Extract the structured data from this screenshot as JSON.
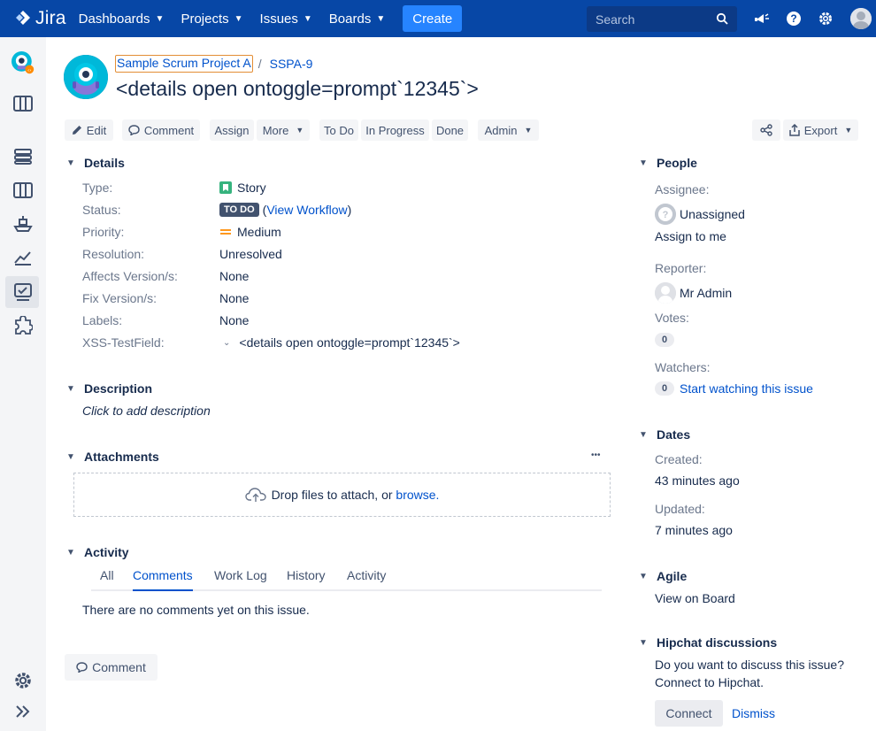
{
  "nav": {
    "logo_text": "Jira",
    "items": [
      {
        "label": "Dashboards"
      },
      {
        "label": "Projects"
      },
      {
        "label": "Issues"
      },
      {
        "label": "Boards"
      }
    ],
    "create_label": "Create",
    "search_placeholder": "Search"
  },
  "header": {
    "project_name": "Sample Scrum Project A",
    "separator": "/",
    "issue_key": "SSPA-9",
    "title": "<details open ontoggle=prompt`12345`>"
  },
  "toolbar": {
    "edit": "Edit",
    "comment": "Comment",
    "assign": "Assign",
    "more": "More",
    "todo": "To Do",
    "in_progress": "In Progress",
    "done": "Done",
    "admin": "Admin",
    "export": "Export"
  },
  "details": {
    "heading": "Details",
    "fields": [
      {
        "label": "Type:",
        "value": "Story"
      },
      {
        "label": "Status:",
        "value": "TO DO",
        "extra_open": "(",
        "link": "View Workflow",
        "extra_close": ")"
      },
      {
        "label": "Priority:",
        "value": "Medium"
      },
      {
        "label": "Resolution:",
        "value": "Unresolved"
      },
      {
        "label": "Affects Version/s:",
        "value": "None"
      },
      {
        "label": "Fix Version/s:",
        "value": "None"
      },
      {
        "label": "Labels:",
        "value": "None"
      },
      {
        "label": "XSS-TestField:",
        "value": "<details open ontoggle=prompt`12345`>"
      }
    ]
  },
  "description": {
    "heading": "Description",
    "placeholder": "Click to add description"
  },
  "attachments": {
    "heading": "Attachments",
    "more": "•••",
    "drop_text": "Drop files to attach, or",
    "browse": "browse."
  },
  "activity": {
    "heading": "Activity",
    "tabs": [
      "All",
      "Comments",
      "Work Log",
      "History",
      "Activity"
    ],
    "active_tab": "Comments",
    "empty": "There are no comments yet on this issue.",
    "comment_button": "Comment"
  },
  "people": {
    "heading": "People",
    "assignee_label": "Assignee:",
    "assignee": "Unassigned",
    "assign_to_me": "Assign to me",
    "reporter_label": "Reporter:",
    "reporter": "Mr Admin",
    "votes_label": "Votes:",
    "votes": "0",
    "watchers_label": "Watchers:",
    "watchers": "0",
    "watch_link": "Start watching this issue"
  },
  "dates": {
    "heading": "Dates",
    "created_label": "Created:",
    "created": "43 minutes ago",
    "updated_label": "Updated:",
    "updated": "7 minutes ago"
  },
  "agile": {
    "heading": "Agile",
    "link": "View on Board"
  },
  "hipchat": {
    "heading": "Hipchat discussions",
    "line1": "Do you want to discuss this issue?",
    "line2": "Connect to Hipchat.",
    "connect": "Connect",
    "dismiss": "Dismiss"
  },
  "colors": {
    "nav_bg": "#0747a6",
    "create_bg": "#2684ff",
    "link": "#0052cc",
    "story_green": "#36b37e",
    "priority_orange": "#ff991f",
    "lozenge": "#42526e"
  }
}
